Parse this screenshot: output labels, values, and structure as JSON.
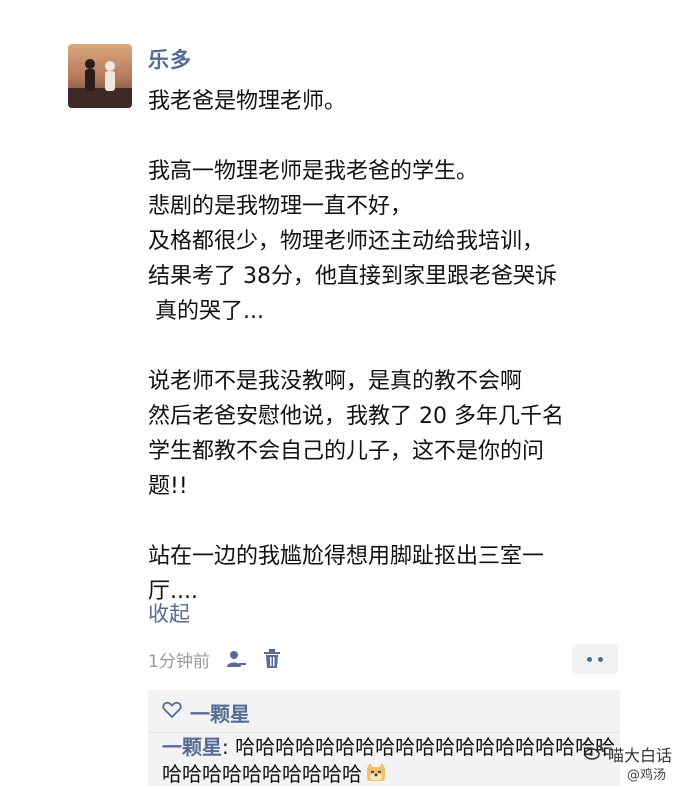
{
  "post": {
    "author": "乐多",
    "lines": [
      "我老爸是物理老师。",
      "",
      "我高一物理老师是我老爸的学生。",
      "悲剧的是我物理一直不好，",
      "及格都很少，物理老师还主动给我培训，",
      "结果考了 38分，他直接到家里跟老爸哭诉",
      " 真的哭了...",
      "",
      "说老师不是我没教啊，是真的教不会啊",
      "然后老爸安慰他说，我教了 20 多年几千名",
      "学生都教不会自己的儿子，这不是你的问",
      "题!!",
      "",
      "站在一边的我尴尬得想用脚趾抠出三室一",
      "厅...."
    ],
    "collapse_label": "收起",
    "time": "1分钟前",
    "icons": {
      "privacy": "person-icon",
      "delete": "trash-icon",
      "more": "more-dots-icon"
    }
  },
  "likes": {
    "icon": "heart-outline-icon",
    "names": "一颗星"
  },
  "comment": {
    "author": "一颗星",
    "separator": ": ",
    "text": "哈哈哈哈哈哈哈哈哈哈哈哈哈哈哈哈哈哈哈哈哈哈哈哈哈哈哈哈哈",
    "emoji": "doge-emoji-icon"
  },
  "watermark": {
    "main": "喵大白话",
    "sub": "@鸡汤"
  },
  "colors": {
    "link": "#576b95",
    "text": "#111111",
    "meta": "#9b9b9b",
    "comment_bg": "#f3f3f5"
  }
}
